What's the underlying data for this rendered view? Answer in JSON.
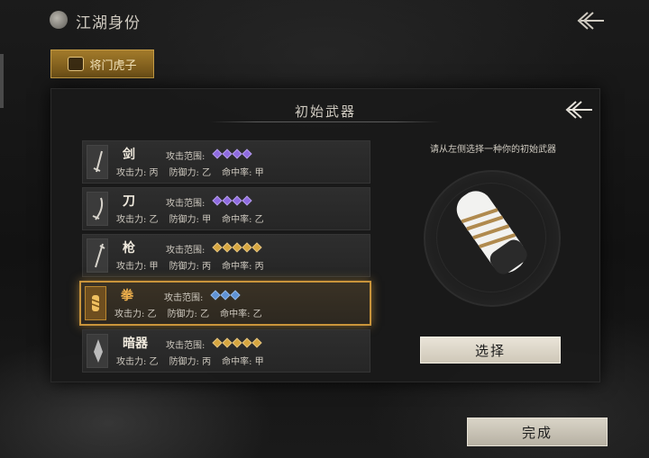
{
  "header": {
    "title": "江湖身份",
    "tab_general": "将门虎子"
  },
  "dialog": {
    "title": "初始武器",
    "hint": "请从左侧选择一种你的初始武器",
    "select_label": "选择"
  },
  "finish_label": "完成",
  "stat_labels": {
    "range": "攻击范围:"
  },
  "weapons": [
    {
      "name": "剑",
      "range_level": 4,
      "diamond_color": "#8f6be0",
      "attack": "攻击力: 丙",
      "defense": "防御力: 乙",
      "hit": "命中率: 甲",
      "selected": false,
      "icon": "sword-icon"
    },
    {
      "name": "刀",
      "range_level": 4,
      "diamond_color": "#8f6be0",
      "attack": "攻击力: 乙",
      "defense": "防御力: 甲",
      "hit": "命中率: 乙",
      "selected": false,
      "icon": "blade-icon"
    },
    {
      "name": "枪",
      "range_level": 5,
      "diamond_color": "#d6a640",
      "attack": "攻击力: 甲",
      "defense": "防御力: 丙",
      "hit": "命中率: 丙",
      "selected": false,
      "icon": "spear-icon"
    },
    {
      "name": "拳",
      "range_level": 3,
      "diamond_color": "#5f93d6",
      "attack": "攻击力: 乙",
      "defense": "防御力: 乙",
      "hit": "命中率: 乙",
      "selected": true,
      "icon": "fist-wrap-icon"
    },
    {
      "name": "暗器",
      "range_level": 5,
      "diamond_color": "#d6a640",
      "attack": "攻击力: 乙",
      "defense": "防御力: 丙",
      "hit": "命中率: 甲",
      "selected": false,
      "icon": "dart-icon"
    }
  ],
  "colors": {
    "accent_gold": "#c9943b",
    "selected_name": "#f0b04c"
  }
}
